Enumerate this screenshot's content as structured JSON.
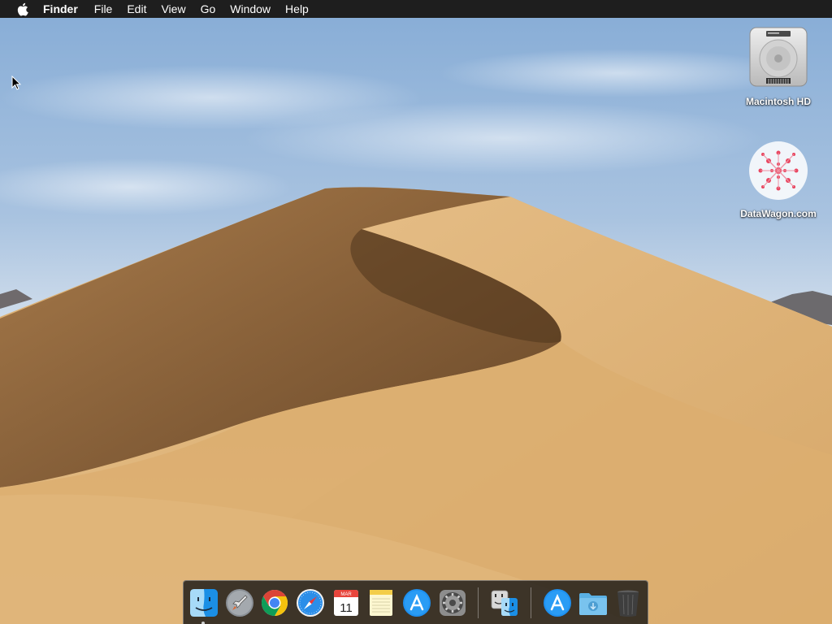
{
  "menubar": {
    "apple_icon": "apple-logo-icon",
    "app_name": "Finder",
    "items": [
      "File",
      "Edit",
      "View",
      "Go",
      "Window",
      "Help"
    ]
  },
  "desktop_icons": [
    {
      "label": "Macintosh HD",
      "icon": "hard-drive-icon"
    },
    {
      "label": "DataWagon.com",
      "icon": "pink-flower-pattern-icon"
    }
  ],
  "dock": {
    "items": [
      {
        "name": "finder",
        "icon": "finder-icon",
        "running": true
      },
      {
        "name": "launchpad",
        "icon": "launchpad-rocket-icon",
        "running": false
      },
      {
        "name": "chrome",
        "icon": "chrome-icon",
        "running": false
      },
      {
        "name": "safari",
        "icon": "safari-compass-icon",
        "running": false
      },
      {
        "name": "calendar",
        "icon": "calendar-icon",
        "running": false,
        "month": "MAR",
        "day": "11"
      },
      {
        "name": "notes",
        "icon": "notes-icon",
        "running": false
      },
      {
        "name": "app-store",
        "icon": "app-store-icon",
        "running": false
      },
      {
        "name": "system-preferences",
        "icon": "system-preferences-gear-icon",
        "running": false
      },
      {
        "name": "migration-assistant",
        "icon": "migration-assistant-icon",
        "running": false
      },
      {
        "name": "app-store-folder",
        "icon": "app-store-icon",
        "running": false
      },
      {
        "name": "downloads-folder",
        "icon": "downloads-folder-icon",
        "running": false
      },
      {
        "name": "trash",
        "icon": "trash-icon",
        "running": false
      }
    ]
  },
  "colors": {
    "menubar_bg": "#1e1e1e",
    "sky_top": "#8fb3d9",
    "sand_light": "#e0b579",
    "sand_dark": "#5a3d20"
  }
}
